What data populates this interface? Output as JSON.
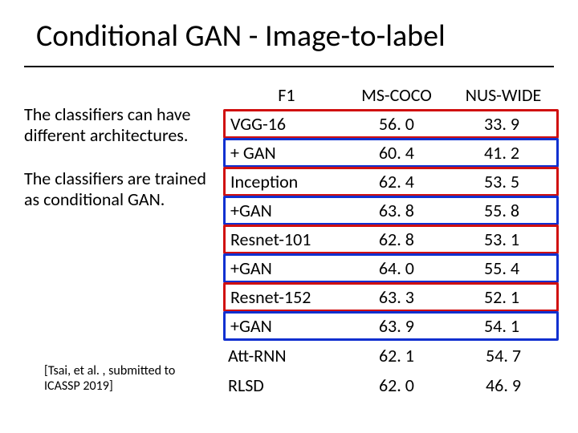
{
  "title": "Conditional GAN - Image-to-label",
  "side": {
    "p1": "The classifiers can have different architectures.",
    "p2": "The classifiers are trained as conditional GAN."
  },
  "citation": "[Tsai, et al. , submitted to ICASSP 2019]",
  "chart_data": {
    "type": "table",
    "columns": [
      "F1",
      "MS-COCO",
      "NUS-WIDE"
    ],
    "rows": [
      {
        "label": "VGG-16",
        "mscoco": "56. 0",
        "nuswide": "33. 9",
        "box": "red"
      },
      {
        "label": "+ GAN",
        "mscoco": "60. 4",
        "nuswide": "41. 2",
        "box": "blue"
      },
      {
        "label": "Inception",
        "mscoco": "62. 4",
        "nuswide": "53. 5",
        "box": "red"
      },
      {
        "label": "+GAN",
        "mscoco": "63. 8",
        "nuswide": "55. 8",
        "box": "blue"
      },
      {
        "label": "Resnet-101",
        "mscoco": "62. 8",
        "nuswide": "53. 1",
        "box": "red"
      },
      {
        "label": "+GAN",
        "mscoco": "64. 0",
        "nuswide": "55. 4",
        "box": "blue"
      },
      {
        "label": "Resnet-152",
        "mscoco": "63. 3",
        "nuswide": "52. 1",
        "box": "red"
      },
      {
        "label": "+GAN",
        "mscoco": "63. 9",
        "nuswide": "54. 1",
        "box": "blue"
      },
      {
        "label": "Att-RNN",
        "mscoco": "62. 1",
        "nuswide": "54. 7",
        "box": "none"
      },
      {
        "label": "RLSD",
        "mscoco": "62. 0",
        "nuswide": "46. 9",
        "box": "none"
      }
    ]
  }
}
